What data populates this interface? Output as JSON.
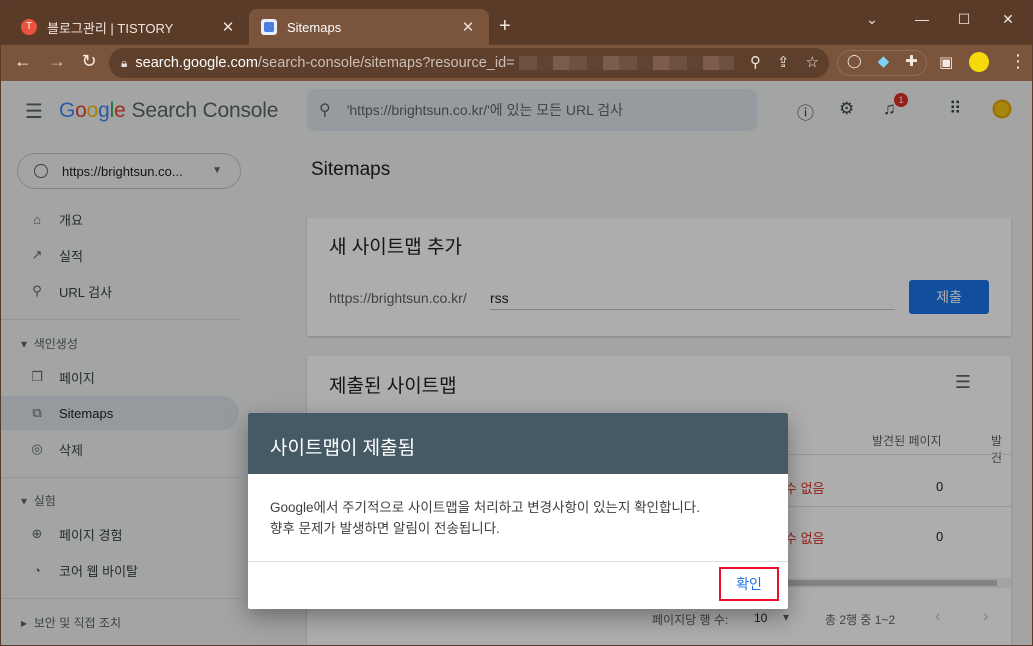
{
  "browser": {
    "tabs": [
      {
        "title": "블로그관리 | TISTORY",
        "favicon": "T"
      },
      {
        "title": "Sitemaps"
      }
    ],
    "url_host": "search.google.com",
    "url_path": "/search-console/sitemaps?resource_id="
  },
  "app": {
    "logo": {
      "g1": "G",
      "g2": "o",
      "g3": "o",
      "g4": "g",
      "g5": "l",
      "g6": "e",
      "product": "Search Console"
    },
    "search_placeholder": "'https://brightsun.co.kr/'에 있는 모든 URL 검사",
    "notification_count": "1"
  },
  "sidebar": {
    "property": "https://brightsun.co...",
    "items": [
      {
        "label": "개요",
        "icon": "home-icon"
      },
      {
        "label": "실적",
        "icon": "trending-up-icon"
      },
      {
        "label": "URL 검사",
        "icon": "search-icon"
      }
    ],
    "group_index": "색인생성",
    "index_items": [
      {
        "label": "페이지",
        "icon": "pages-icon"
      },
      {
        "label": "Sitemaps",
        "icon": "sitemap-icon"
      },
      {
        "label": "삭제",
        "icon": "removals-icon"
      }
    ],
    "group_experience": "실험",
    "exp_items": [
      {
        "label": "페이지 경험",
        "icon": "plus-circle-icon"
      },
      {
        "label": "코어 웹 바이탈",
        "icon": "gauge-icon"
      }
    ],
    "group_security": "보안 및 직접 조치"
  },
  "main": {
    "title": "Sitemaps",
    "add_card": {
      "title": "새 사이트맵 추가",
      "prefix": "https://brightsun.co.kr/",
      "input_value": "rss",
      "submit_label": "제출"
    },
    "submitted_card": {
      "title": "제출된 사이트맵",
      "col_discovered": "발견된 페이지",
      "col_next": "발견",
      "rows": [
        {
          "status": "수 없음",
          "discovered": "0"
        },
        {
          "status": "수 없음",
          "discovered": "0"
        }
      ],
      "rows_per_page_label": "페이지당 행 수:",
      "rows_per_page": "10",
      "range": "총 2행 중 1~2"
    }
  },
  "dialog": {
    "title": "사이트맵이 제출됨",
    "body_line1": "Google에서 주기적으로 사이트맵을 처리하고 변경사항이 있는지 확인합니다.",
    "body_line2": "향후 문제가 발생하면 알림이 전송됩니다.",
    "ok_label": "확인"
  }
}
